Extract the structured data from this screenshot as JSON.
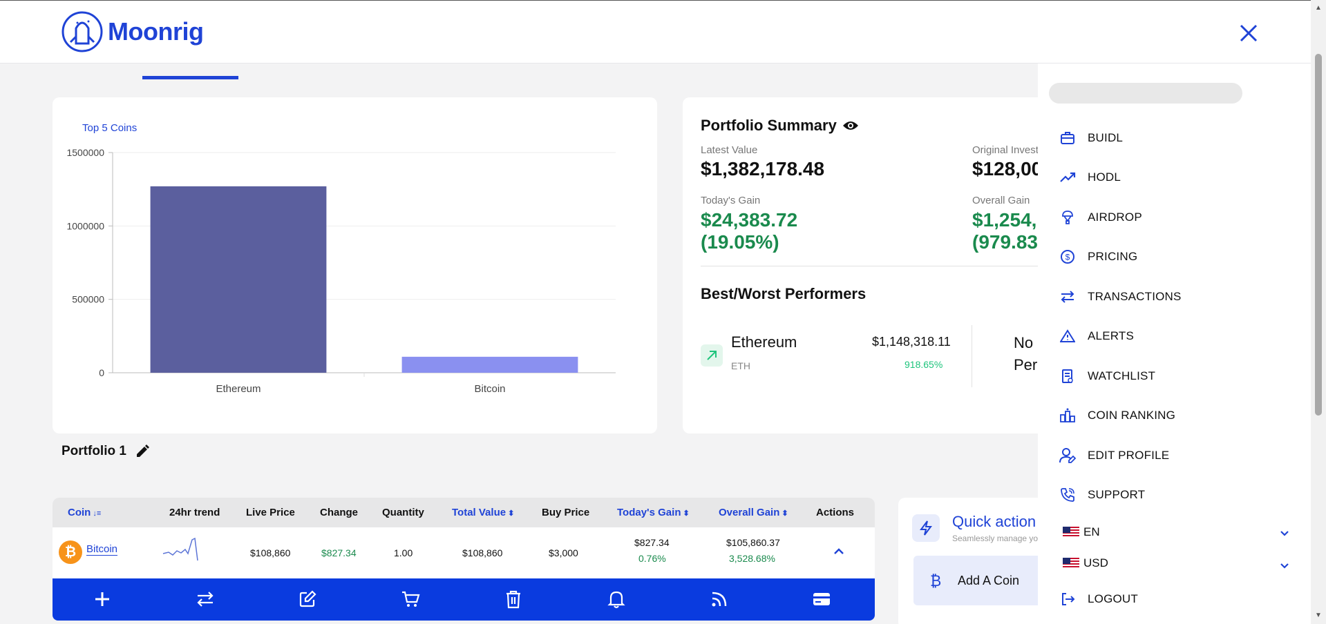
{
  "header": {
    "logo_text": "Moonrig"
  },
  "chart_section": {
    "title": "Top 5 Coins"
  },
  "chart_data": {
    "type": "bar",
    "title": "Top 5 Coins",
    "categories": [
      "Ethereum",
      "Bitcoin"
    ],
    "values": [
      1270000,
      108860
    ],
    "ylim": [
      0,
      1500000
    ],
    "yticks": [
      "1500000",
      "1000000",
      "500000",
      "0"
    ],
    "grid": true,
    "colors": [
      "#5b5f9e",
      "#8a90f0"
    ]
  },
  "summary": {
    "title": "Portfolio Summary",
    "latest_value_label": "Latest Value",
    "latest_value": "$1,382,178.48",
    "original_invest_label": "Original Invest",
    "original_invest": "$128,00",
    "todays_gain_label": "Today's Gain",
    "todays_gain": "$24,383.72",
    "todays_gain_pct": "(19.05%)",
    "overall_gain_label": "Overall Gain",
    "overall_gain": "$1,254,1",
    "overall_gain_pct": "(979.83",
    "best_worst_title": "Best/Worst Performers",
    "best": {
      "name": "Ethereum",
      "symbol": "ETH",
      "value": "$1,148,318.11",
      "pct": "918.65%"
    },
    "worst_line1": "No",
    "worst_line2": "Per"
  },
  "portfolio": {
    "name": "Portfolio 1"
  },
  "table": {
    "headers": {
      "coin": "Coin",
      "trend": "24hr trend",
      "live_price": "Live Price",
      "change": "Change",
      "quantity": "Quantity",
      "total_value": "Total Value",
      "buy_price": "Buy Price",
      "todays_gain": "Today's Gain",
      "overall_gain": "Overall Gain",
      "actions": "Actions"
    },
    "rows": [
      {
        "coin": "Bitcoin",
        "coin_symbol": "₿",
        "live_price": "$108,860",
        "change": "$827.34",
        "quantity": "1.00",
        "total_value": "$108,860",
        "buy_price": "$3,000",
        "todays_gain": "$827.34",
        "todays_gain_pct": "0.76%",
        "overall_gain": "$105,860.37",
        "overall_gain_pct": "3,528.68%"
      }
    ]
  },
  "toolbar_icons": [
    "plus-icon",
    "swap-icon",
    "edit-icon",
    "cart-icon",
    "trash-icon",
    "bell-icon",
    "rss-icon",
    "card-icon"
  ],
  "quick_actions": {
    "title": "Quick action",
    "subtitle": "Seamlessly manage yo",
    "add_coin_label": "Add A Coin",
    "add_coin_icon": "₿"
  },
  "drawer": {
    "menu": [
      {
        "label": "BUIDL",
        "icon": "briefcase-icon"
      },
      {
        "label": "HODL",
        "icon": "trend-up-icon"
      },
      {
        "label": "AIRDROP",
        "icon": "airdrop-icon"
      },
      {
        "label": "PRICING",
        "icon": "dollar-circle-icon"
      },
      {
        "label": "TRANSACTIONS",
        "icon": "swap-icon"
      },
      {
        "label": "ALERTS",
        "icon": "warning-icon"
      },
      {
        "label": "WATCHLIST",
        "icon": "watchlist-icon"
      },
      {
        "label": "COIN RANKING",
        "icon": "ranking-icon"
      },
      {
        "label": "EDIT PROFILE",
        "icon": "user-edit-icon"
      },
      {
        "label": "SUPPORT",
        "icon": "phone-icon"
      }
    ],
    "language": "EN",
    "currency": "USD",
    "logout": "LOGOUT"
  },
  "colors": {
    "brand": "#1f43d6",
    "gain": "#1a8a4d",
    "toolbar": "#0a3bdf"
  }
}
